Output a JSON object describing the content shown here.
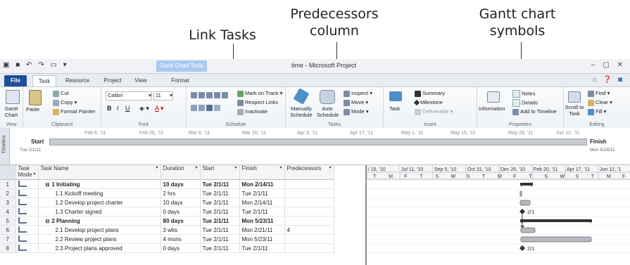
{
  "callouts": {
    "link_tasks": "Link Tasks",
    "predecessors_line1": "Predecessors",
    "predecessors_line2": "column",
    "gantt_line1": "Gantt chart",
    "gantt_line2": "symbols"
  },
  "window": {
    "context_tab": "Gantt Chart Tools",
    "title": "time - Microsoft Project"
  },
  "tabs": [
    "File",
    "Task",
    "Resource",
    "Project",
    "View",
    "Format"
  ],
  "ribbon": {
    "view": {
      "label": "View",
      "gantt_chart": "Gantt Chart"
    },
    "clipboard": {
      "label": "Clipboard",
      "paste": "Paste",
      "cut": "Cut",
      "copy": "Copy",
      "format_painter": "Format Painter"
    },
    "font": {
      "label": "Font",
      "font_name": "Calibri",
      "font_size": "11"
    },
    "schedule": {
      "label": "Schedule",
      "mark_on_track": "Mark on Track",
      "respect_links": "Respect Links",
      "inactivate": "Inactivate",
      "percents": [
        "0x",
        "25x",
        "50x",
        "75x",
        "100x"
      ]
    },
    "tasks": {
      "label": "Tasks",
      "manually_schedule": "Manually Schedule",
      "auto_schedule": "Auto Schedule",
      "inspect": "Inspect",
      "move": "Move",
      "mode": "Mode"
    },
    "insert": {
      "label": "Insert",
      "task": "Task",
      "summary": "Summary",
      "milestone": "Milestone",
      "deliverable": "Deliverable"
    },
    "properties": {
      "label": "Properties",
      "information": "Information",
      "notes": "Notes",
      "details": "Details",
      "add_to_timeline": "Add to Timeline"
    },
    "editing": {
      "label": "Editing",
      "scroll_to_task": "Scroll to Task",
      "find": "Find",
      "clear": "Clear",
      "fill": "Fill"
    }
  },
  "timeline": {
    "side_label": "Timeline",
    "dates": [
      "Feb 6, '11",
      "Feb 20, '11",
      "Mar 6, '11",
      "Mar 20, '11",
      "Apr 3, '11",
      "Apr 17, '11",
      "May 1, '11",
      "May 15, '11",
      "May 29, '11",
      "Jun 12, '11"
    ],
    "start_label": "Start",
    "start_date": "Tue 2/1/11",
    "finish_label": "Finish",
    "finish_date": "Mon 6/28/11"
  },
  "grid": {
    "columns": {
      "mode": "Task Mode",
      "name": "Task Name",
      "duration": "Duration",
      "start": "Start",
      "finish": "Finish",
      "predecessors": "Predecessors"
    },
    "rows": [
      {
        "id": "1",
        "name": "1 Initiating",
        "duration": "10 days",
        "start": "Tue 2/1/11",
        "finish": "Mon 2/14/11",
        "pred": "",
        "summary": true
      },
      {
        "id": "2",
        "name": "1.1 Kickoff meeting",
        "duration": "2 hrs",
        "start": "Tue 2/1/11",
        "finish": "Tue 2/1/11",
        "pred": "",
        "summary": false
      },
      {
        "id": "3",
        "name": "1.2 Develop project charter",
        "duration": "10 days",
        "start": "Tue 2/1/11",
        "finish": "Mon 2/14/11",
        "pred": "",
        "summary": false
      },
      {
        "id": "4",
        "name": "1.3 Charter signed",
        "duration": "0 days",
        "start": "Tue 2/1/11",
        "finish": "Tue 2/1/11",
        "pred": "",
        "summary": false
      },
      {
        "id": "5",
        "name": "2 Planning",
        "duration": "80 days",
        "start": "Tue 2/1/11",
        "finish": "Mon 5/23/11",
        "pred": "",
        "summary": true
      },
      {
        "id": "6",
        "name": "2.1 Develop project plans",
        "duration": "3 wks",
        "start": "Tue 2/1/11",
        "finish": "Mon 2/21/11",
        "pred": "4",
        "summary": false
      },
      {
        "id": "7",
        "name": "2.2 Review project plans",
        "duration": "4 mons",
        "start": "Tue 2/1/11",
        "finish": "Mon 5/23/11",
        "pred": "",
        "summary": false
      },
      {
        "id": "8",
        "name": "2.3 Project plans approved",
        "duration": "0 days",
        "start": "Tue 2/1/11",
        "finish": "Tue 2/1/11",
        "pred": "",
        "summary": false
      }
    ]
  },
  "gantt": {
    "periods": [
      "/ 16, '10",
      "Jul 11, '10",
      "Sep 5, '10",
      "Oct 31, '10",
      "Dec 26, '10",
      "Feb 20, '11",
      "Apr 17, '11",
      "Jun 12, '1"
    ],
    "days": [
      "T",
      "M",
      "F",
      "T",
      "S",
      "W",
      "S",
      "T",
      "M",
      "F",
      "T",
      "S",
      "W",
      "S",
      "T",
      "M",
      "F"
    ],
    "milestone_labels": {
      "row4": "2/1",
      "row8": "2/1"
    }
  },
  "colors": {
    "file_tab": "#1f4f9a",
    "bar": "#b5b9be",
    "summary_bar": "#2b2b2b"
  }
}
